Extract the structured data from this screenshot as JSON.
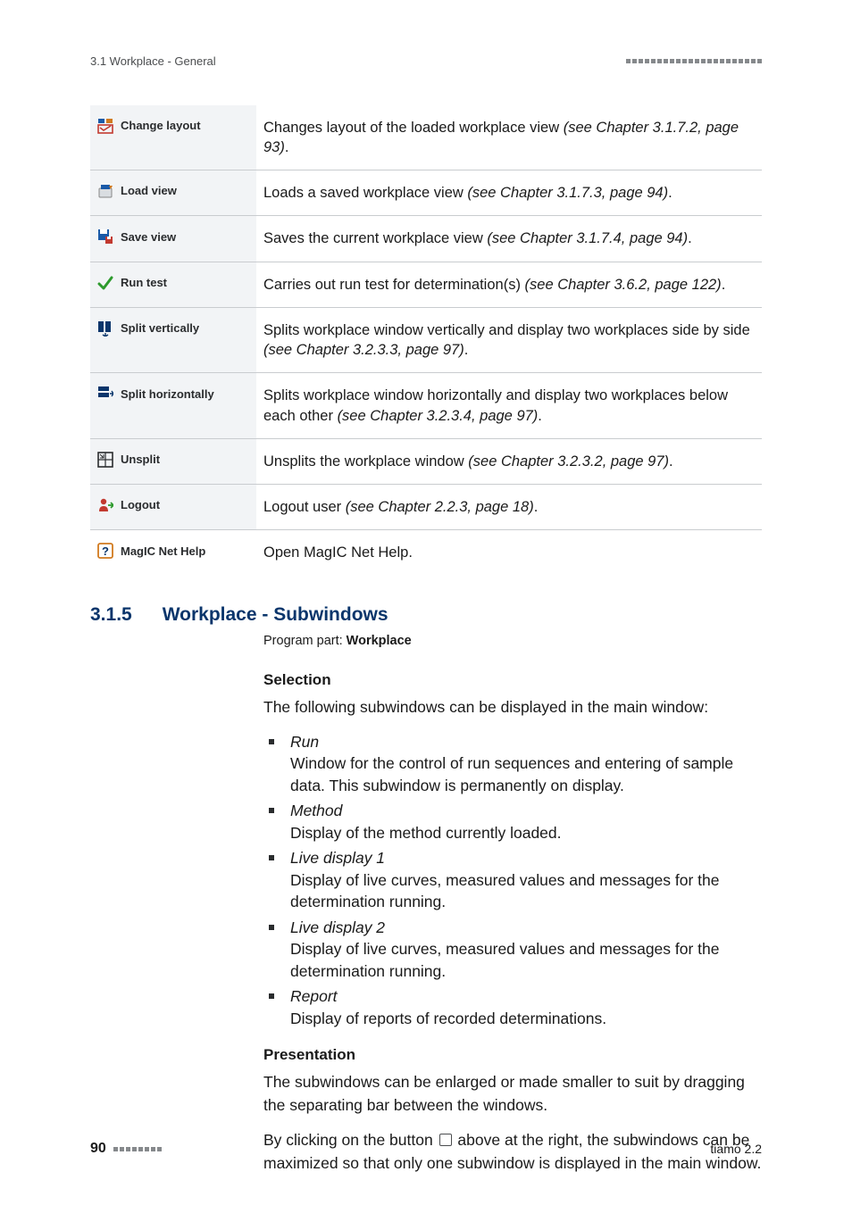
{
  "running_header": {
    "left": "3.1 Workplace - General"
  },
  "toolbar_rows": [
    {
      "icon": "change-layout-icon",
      "label": "Change layout",
      "desc_pre": "Changes layout of the loaded workplace view ",
      "desc_ref": "(see Chapter 3.1.7.2, page 93)",
      "desc_post": "."
    },
    {
      "icon": "load-view-icon",
      "label": "Load view",
      "desc_pre": "Loads a saved workplace view ",
      "desc_ref": "(see Chapter 3.1.7.3, page 94)",
      "desc_post": "."
    },
    {
      "icon": "save-view-icon",
      "label": "Save view",
      "desc_pre": "Saves the current workplace view ",
      "desc_ref": "(see Chapter 3.1.7.4, page 94)",
      "desc_post": "."
    },
    {
      "icon": "run-test-icon",
      "label": "Run test",
      "desc_pre": "Carries out run test for determination(s) ",
      "desc_ref": "(see Chapter 3.6.2, page 122)",
      "desc_post": "."
    },
    {
      "icon": "split-vert-icon",
      "label": "Split vertically",
      "desc_pre": "Splits workplace window vertically and display two workplaces side by side ",
      "desc_ref": "(see Chapter 3.2.3.3, page 97)",
      "desc_post": "."
    },
    {
      "icon": "split-horiz-icon",
      "label": "Split horizontally",
      "desc_pre": "Splits workplace window horizontally and display two workplaces below each other ",
      "desc_ref": "(see Chapter 3.2.3.4, page 97)",
      "desc_post": "."
    },
    {
      "icon": "unsplit-icon",
      "label": "Unsplit",
      "desc_pre": "Unsplits the workplace window ",
      "desc_ref": "(see Chapter 3.2.3.2, page 97)",
      "desc_post": "."
    },
    {
      "icon": "logout-icon",
      "label": "Logout",
      "desc_pre": "Logout user ",
      "desc_ref": "(see Chapter 2.2.3, page 18)",
      "desc_post": "."
    },
    {
      "icon": "help-icon",
      "label": "MagIC Net Help",
      "plain": true,
      "desc_pre": "Open MagIC Net Help.",
      "desc_ref": "",
      "desc_post": ""
    }
  ],
  "section": {
    "num": "3.1.5",
    "title": "Workplace - Subwindows",
    "program_part_label": "Program part: ",
    "program_part_value": "Workplace"
  },
  "subheads": {
    "selection": "Selection",
    "presentation": "Presentation"
  },
  "selection_intro": "The following subwindows can be displayed in the main window:",
  "selection_items": [
    {
      "name": "Run",
      "desc": "Window for the control of run sequences and entering of sample data. This subwindow is permanently on display."
    },
    {
      "name": "Method",
      "desc": "Display of the method currently loaded."
    },
    {
      "name": "Live display 1",
      "desc": "Display of live curves, measured values and messages for the determination running."
    },
    {
      "name": "Live display 2",
      "desc": "Display of live curves, measured values and messages for the determination running."
    },
    {
      "name": "Report",
      "desc": "Display of reports of recorded determinations."
    }
  ],
  "presentation_paras": {
    "p1": "The subwindows can be enlarged or made smaller to suit by dragging the separating bar between the windows.",
    "p2a": "By clicking on the button ",
    "p2b": " above at the right, the subwindows can be maximized so that only one subwindow is displayed in the main window."
  },
  "footer": {
    "page_number": "90",
    "product": "tiamo 2.2"
  }
}
